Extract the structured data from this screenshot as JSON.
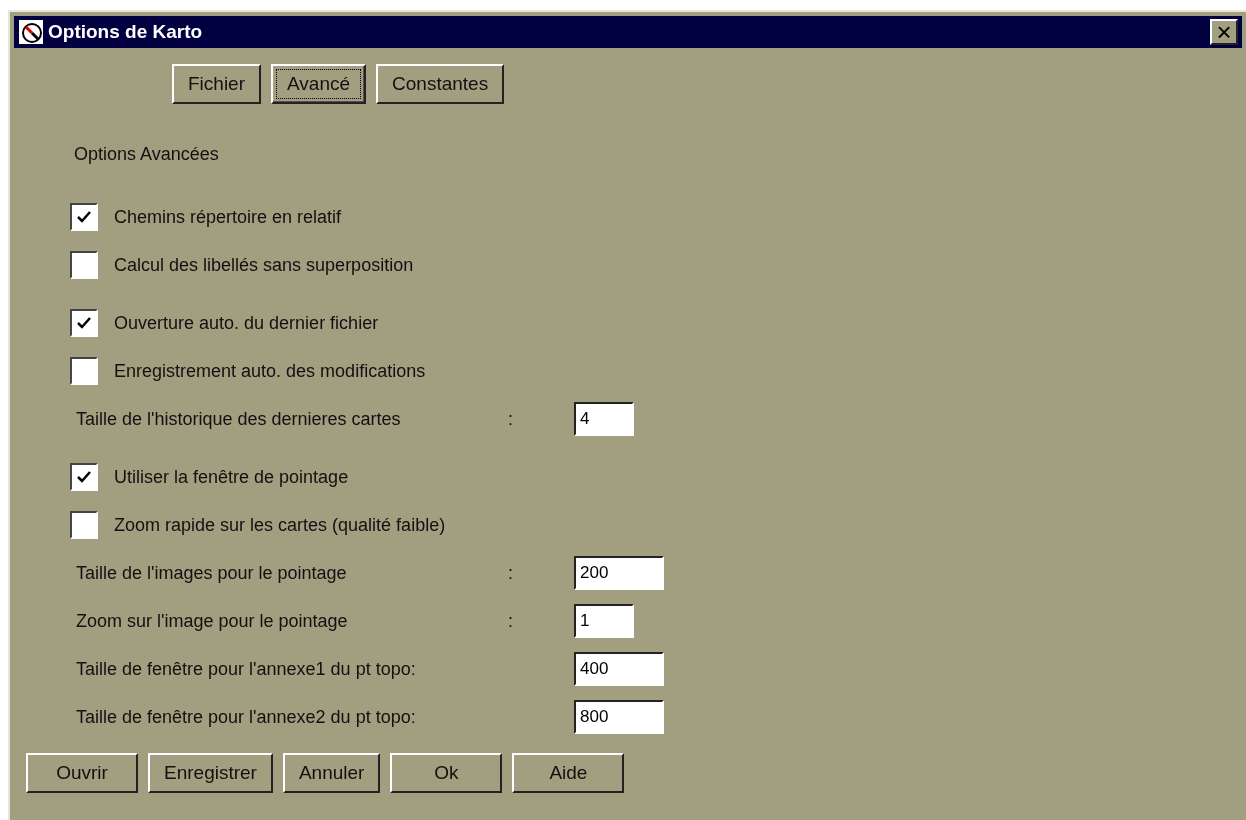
{
  "window": {
    "title": "Options de Karto",
    "close": "×"
  },
  "tabs": [
    {
      "label": "Fichier",
      "selected": false
    },
    {
      "label": "Avancé",
      "selected": true
    },
    {
      "label": "Constantes",
      "selected": false
    }
  ],
  "section_title": "Options Avancées",
  "groups": [
    [
      {
        "kind": "checkbox",
        "label": "Chemins répertoire en relatif",
        "checked": true
      },
      {
        "kind": "checkbox",
        "label": "Calcul des libellés sans superposition",
        "checked": false
      }
    ],
    [
      {
        "kind": "checkbox",
        "label": "Ouverture auto. du dernier fichier",
        "checked": true
      },
      {
        "kind": "checkbox",
        "label": "Enregistrement auto. des modifications",
        "checked": false
      },
      {
        "kind": "field",
        "label": "Taille de l'historique des dernieres cartes",
        "colon": ":",
        "value": "4"
      }
    ],
    [
      {
        "kind": "checkbox",
        "label": "Utiliser la fenêtre de pointage",
        "checked": true
      },
      {
        "kind": "checkbox",
        "label": "Zoom rapide sur les cartes (qualité faible)",
        "checked": false
      },
      {
        "kind": "field",
        "label": "Taille de l'images pour le pointage",
        "colon": ":",
        "value": "200"
      },
      {
        "kind": "field",
        "label": "Zoom sur l'image pour le pointage",
        "colon": ":",
        "value": "1"
      },
      {
        "kind": "field",
        "label": "Taille de fenêtre pour l'annexe1 du pt topo:",
        "value": "400"
      },
      {
        "kind": "field",
        "label": "Taille de fenêtre pour l'annexe2 du pt topo:",
        "value": "800"
      }
    ]
  ],
  "buttons": [
    "Ouvrir",
    "Enregistrer",
    "Annuler",
    "Ok",
    "Aide"
  ]
}
